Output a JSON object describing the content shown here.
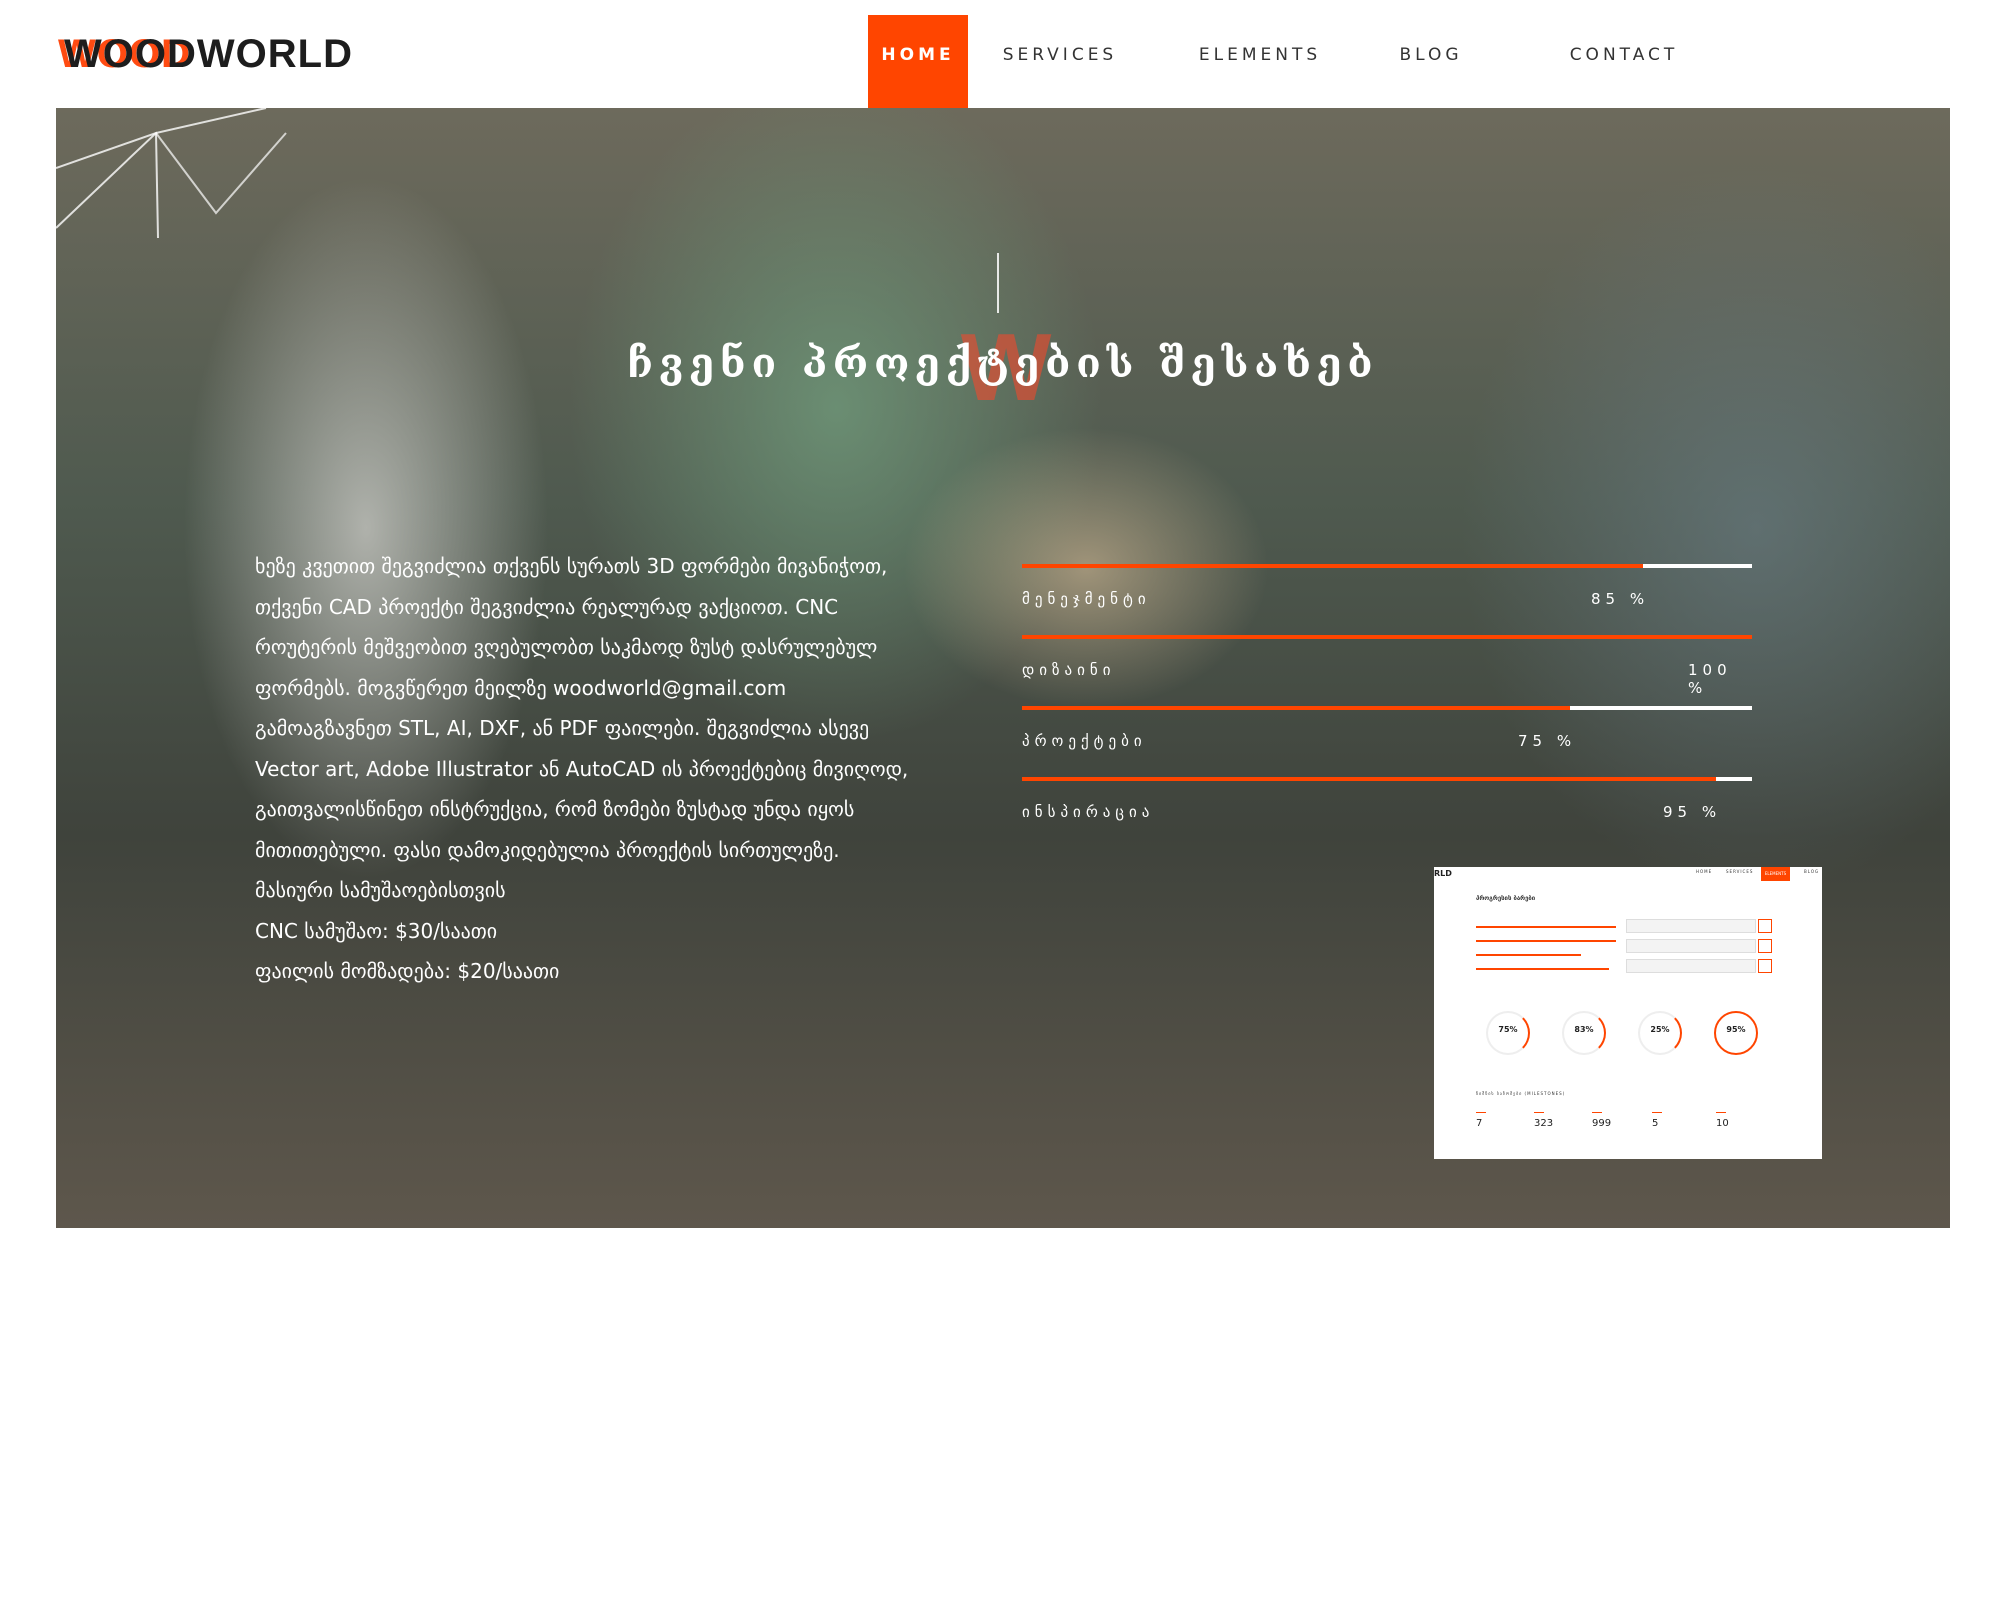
{
  "header": {
    "logo_part1": "WOOD",
    "logo_part2": "WORLD",
    "nav": [
      {
        "label": "HOME",
        "active": true
      },
      {
        "label": "SERVICES",
        "active": false
      },
      {
        "label": "ELEMENTS",
        "active": false
      },
      {
        "label": "BLOG",
        "active": false
      },
      {
        "label": "CONTACT",
        "active": false
      }
    ]
  },
  "hero": {
    "mark": "W",
    "title": "ჩვენი პროექტების შესახებ",
    "paragraph": "ხეზე კვეთით შეგვიძლია თქვენს სურათს 3D ფორმები მივანიჭოთ, თქვენი CAD პროექტი შეგვიძლია რეალურად ვაქციოთ. CNC როუტერის მეშვეობით ვღებულობთ საკმაოდ ზუსტ დასრულებულ ფორმებს. მოგვწერეთ მეილზე woodworld@gmail.com გამოაგზავნეთ STL, AI, DXF, ან PDF ფაილები. შეგვიძლია ასევე Vector art, Adobe Illustrator ან AutoCAD ის პროექტებიც მივიღოდ, გაითვალისწინეთ ინსტრუქცია, რომ ზომები ზუსტად უნდა იყოს მითითებული. ფასი დამოკიდებულია პროექტის სირთულეზე.",
    "line1": "მასიური სამუშაოებისთვის",
    "line2": "CNC სამუშაო: $30/საათი",
    "line3": "ფაილის მომზადება: $20/საათი"
  },
  "skills": [
    {
      "label": "მენეჯმენტი",
      "value_text": "85 %",
      "value": 85
    },
    {
      "label": "დიზაინი",
      "value_text": "100 %",
      "value": 100
    },
    {
      "label": "პროექტები",
      "value_text": "75 %",
      "value": 75
    },
    {
      "label": "ინსპირაცია",
      "value_text": "95 %",
      "value": 95
    }
  ],
  "thumbnail": {
    "logo": "RLD",
    "nav": [
      "HOME",
      "SERVICES",
      "ELEMENTS",
      "BLOG"
    ],
    "heading": "პროგრესის ბარები",
    "circles": [
      {
        "value": "75%"
      },
      {
        "value": "83%"
      },
      {
        "value": "25%"
      },
      {
        "value": "95%"
      }
    ],
    "milestones_title": "ნიშნის საზომები (MILESTONES)",
    "milestones": [
      "7",
      "323",
      "999",
      "5",
      "10"
    ]
  },
  "colors": {
    "accent": "#ff4500",
    "text_dark": "#1d1d1d"
  }
}
